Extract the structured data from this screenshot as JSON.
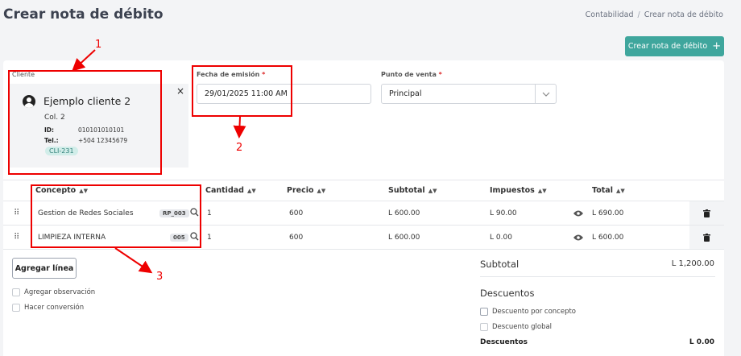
{
  "header": {
    "title": "Crear nota de débito",
    "breadcrumb": [
      "Contabilidad",
      "/",
      "Crear nota de débito"
    ],
    "create_button": "Crear nota de débito",
    "create_icon": "plus-icon"
  },
  "client": {
    "label": "Cliente",
    "name": "Ejemplo cliente 2",
    "address": "Col. 2",
    "id_label": "ID:",
    "id_value": "010101010101",
    "tel_label": "Tel.:",
    "tel_value": "+504 12345679",
    "code": "CLI-231",
    "close": "×"
  },
  "fecha": {
    "label": "Fecha de emisión",
    "required": "*",
    "value": "29/01/2025 11:00 AM"
  },
  "punto_venta": {
    "label": "Punto de venta",
    "required": "*",
    "value": "Principal"
  },
  "table": {
    "columns": [
      "Concepto",
      "Cantidad",
      "Precio",
      "Subtotal",
      "Impuestos",
      "Total"
    ],
    "rows": [
      {
        "concepto": "Gestion de Redes Sociales",
        "code": "RP_003",
        "cantidad": "1",
        "precio": "600",
        "subtotal": "L 600.00",
        "impuestos": "L 90.00",
        "total": "L 690.00"
      },
      {
        "concepto": "LIMPIEZA INTERNA",
        "code": "005",
        "cantidad": "1",
        "precio": "600",
        "subtotal": "L 600.00",
        "impuestos": "L 0.00",
        "total": "L 600.00"
      }
    ]
  },
  "actions": {
    "add_line": "Agregar línea",
    "add_observation": "Agregar observación",
    "conversion": "Hacer conversión"
  },
  "summary": {
    "subtotal_label": "Subtotal",
    "subtotal_value": "L 1,200.00",
    "discounts_title": "Descuentos",
    "discount_concept": "Descuento por concepto",
    "discount_global": "Descuento global",
    "discounts_label": "Descuentos",
    "discounts_value": "L 0.00"
  },
  "annotations": [
    "1",
    "2",
    "3"
  ],
  "colors": {
    "accent": "#3fa69d",
    "annotation": "#e00000"
  }
}
